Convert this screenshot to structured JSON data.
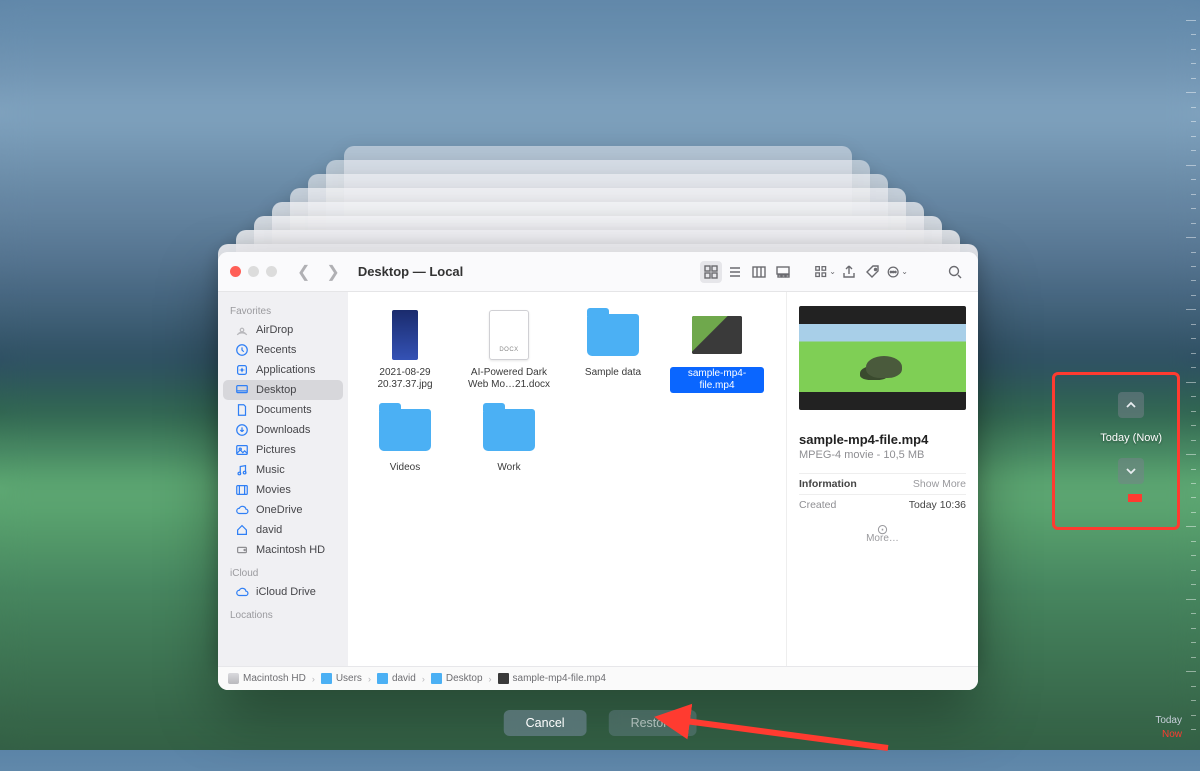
{
  "window": {
    "title": "Desktop — Local"
  },
  "sidebar": {
    "sections": [
      {
        "header": "Favorites",
        "items": [
          {
            "label": "AirDrop",
            "icon": "airdrop"
          },
          {
            "label": "Recents",
            "icon": "clock"
          },
          {
            "label": "Applications",
            "icon": "app"
          },
          {
            "label": "Desktop",
            "icon": "desktop",
            "selected": true
          },
          {
            "label": "Documents",
            "icon": "doc"
          },
          {
            "label": "Downloads",
            "icon": "download"
          },
          {
            "label": "Pictures",
            "icon": "picture"
          },
          {
            "label": "Music",
            "icon": "music"
          },
          {
            "label": "Movies",
            "icon": "movie"
          },
          {
            "label": "OneDrive",
            "icon": "cloud"
          },
          {
            "label": "david",
            "icon": "home"
          },
          {
            "label": "Macintosh HD",
            "icon": "disk"
          }
        ]
      },
      {
        "header": "iCloud",
        "items": [
          {
            "label": "iCloud Drive",
            "icon": "cloud"
          }
        ]
      },
      {
        "header": "Locations",
        "items": []
      }
    ]
  },
  "files": [
    {
      "name": "2021-08-29 20.37.37.jpg",
      "kind": "jpg"
    },
    {
      "name": "AI-Powered Dark Web Mo…21.docx",
      "kind": "docx"
    },
    {
      "name": "Sample data",
      "kind": "folder"
    },
    {
      "name": "sample-mp4-file.mp4",
      "kind": "mp4",
      "selected": true
    },
    {
      "name": "Videos",
      "kind": "folder"
    },
    {
      "name": "Work",
      "kind": "folder"
    }
  ],
  "preview": {
    "name": "sample-mp4-file.mp4",
    "subtitle": "MPEG-4 movie - 10,5 MB",
    "info_header": "Information",
    "show_more": "Show More",
    "rows": [
      {
        "k": "Created",
        "v": "Today 10:36"
      }
    ],
    "more": "More…"
  },
  "pathbar": [
    {
      "label": "Macintosh HD",
      "icon": "disk"
    },
    {
      "label": "Users",
      "icon": "folder"
    },
    {
      "label": "david",
      "icon": "folder"
    },
    {
      "label": "Desktop",
      "icon": "folder"
    },
    {
      "label": "sample-mp4-file.mp4",
      "icon": "file"
    }
  ],
  "buttons": {
    "cancel": "Cancel",
    "restore": "Restore"
  },
  "timemachine": {
    "label": "Today (Now)"
  },
  "timeline_labels": {
    "today": "Today",
    "now": "Now"
  }
}
